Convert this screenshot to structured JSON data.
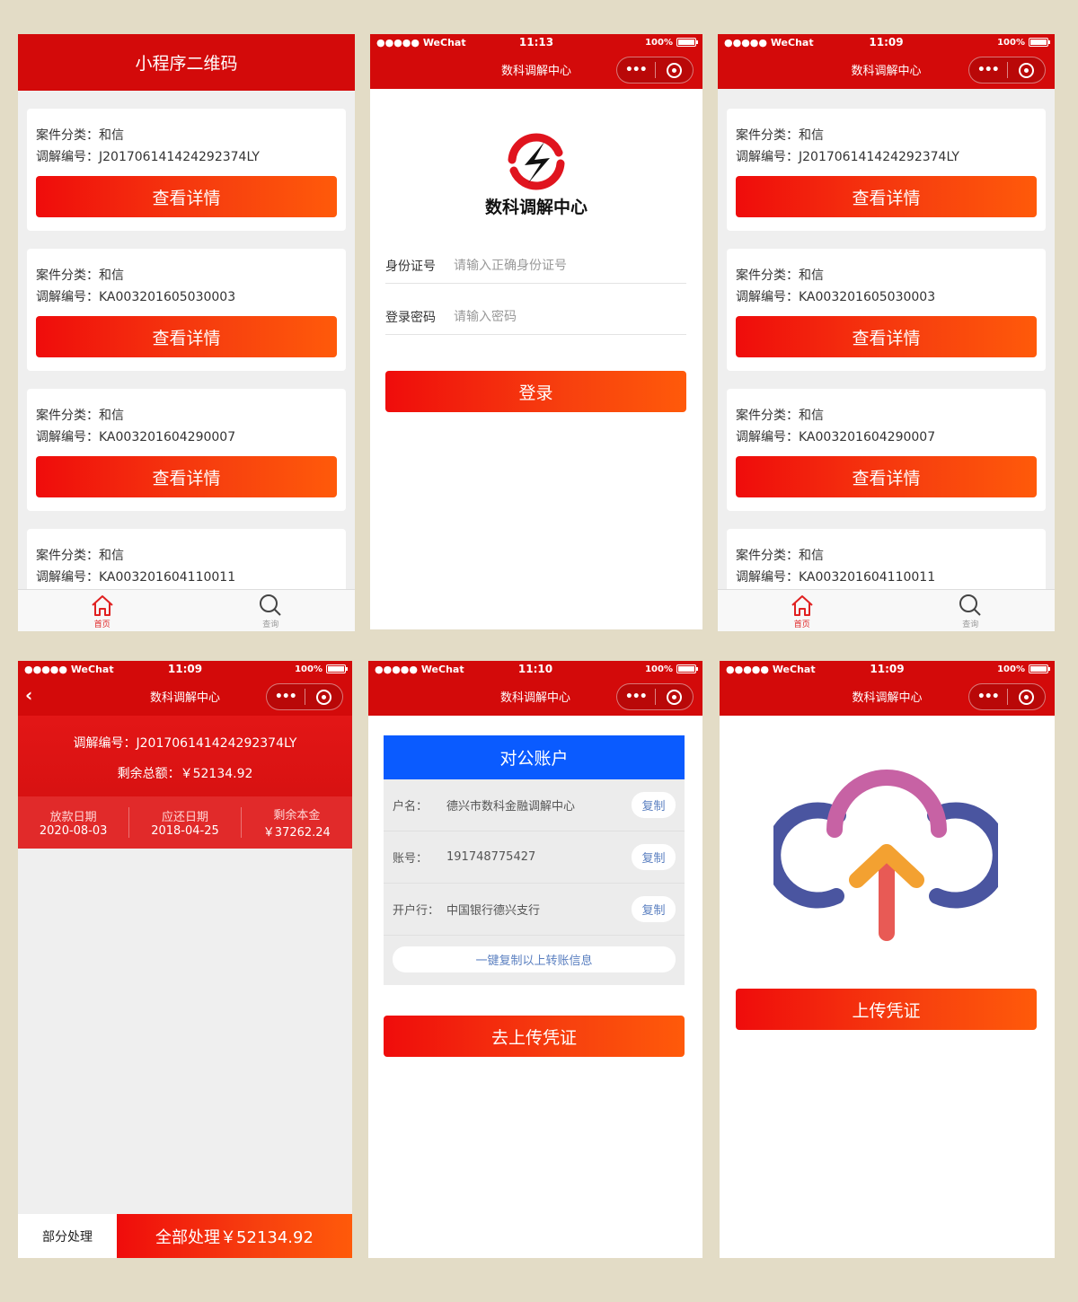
{
  "colors": {
    "brand_red": "#d30a0a",
    "gradient_start": "#ef0c0c",
    "gradient_end": "#ff5a0a",
    "account_blue": "#0a5bff",
    "page_bg": "#e3dcc6"
  },
  "common": {
    "carrier": "●●●●● WeChat",
    "battery": "100%",
    "nav_title": "数科调解中心",
    "capsule_more": "•••",
    "view_detail": "查看详情",
    "label_category": "案件分类：",
    "label_code": "调解编号："
  },
  "screen1": {
    "title": "小程序二维码",
    "cards": [
      {
        "category": "和信",
        "code": "J201706141424292374LY"
      },
      {
        "category": "和信",
        "code": "KA003201605030003"
      },
      {
        "category": "和信",
        "code": "KA003201604290007"
      },
      {
        "category": "和信",
        "code": "KA003201604110011"
      }
    ],
    "tabs": [
      {
        "label": "首页",
        "icon": "home-icon"
      },
      {
        "label": "查询",
        "icon": "search-icon"
      }
    ]
  },
  "screen2": {
    "time": "11:13",
    "logo_text": "数科调解中心",
    "id_label": "身份证号",
    "id_placeholder": "请输入正确身份证号",
    "pwd_label": "登录密码",
    "pwd_placeholder": "请输入密码",
    "login": "登录"
  },
  "screen3": {
    "time": "11:09",
    "cards": [
      {
        "category": "和信",
        "code": "J201706141424292374LY"
      },
      {
        "category": "和信",
        "code": "KA003201605030003"
      },
      {
        "category": "和信",
        "code": "KA003201604290007"
      },
      {
        "category": "和信",
        "code": "KA003201604110011"
      }
    ],
    "tabs": [
      {
        "label": "首页",
        "icon": "home-icon"
      },
      {
        "label": "查询",
        "icon": "search-icon"
      }
    ]
  },
  "screen4": {
    "time": "11:09",
    "code_line": "调解编号：J201706141424292374LY",
    "remaining_line": "剩余总额：￥52134.92",
    "cols": [
      {
        "k": "放款日期",
        "v": "2020-08-03"
      },
      {
        "k": "应还日期",
        "v": "2018-04-25"
      },
      {
        "k": "剩余本金",
        "v": "￥37262.24"
      }
    ],
    "partial": "部分处理",
    "all": "全部处理￥52134.92"
  },
  "screen5": {
    "time": "11:10",
    "head": "对公账户",
    "rows": [
      {
        "k": "户名：",
        "v": "德兴市数科金融调解中心"
      },
      {
        "k": "账号：",
        "v": "191748775427"
      },
      {
        "k": "开户行：",
        "v": "中国银行德兴支行"
      }
    ],
    "copy": "复制",
    "copy_all": "一键复制以上转账信息",
    "upload": "去上传凭证"
  },
  "screen6": {
    "time": "11:09",
    "upload": "上传凭证"
  }
}
